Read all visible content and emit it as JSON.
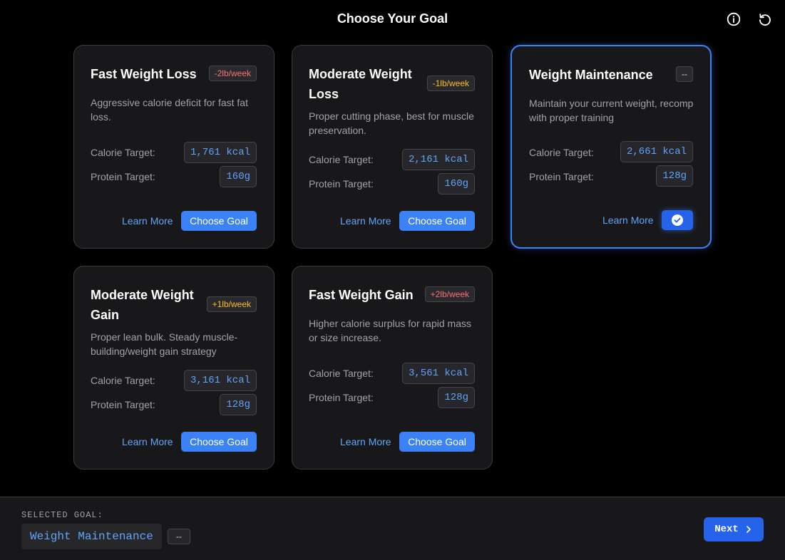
{
  "header": {
    "title": "Choose Your Goal",
    "icons": [
      "info-icon",
      "reset-icon"
    ]
  },
  "cards": [
    {
      "title": "Fast Weight Loss",
      "badge": "-2lb/week",
      "badge_color": "#f87171",
      "description": "Aggressive calorie deficit for fast fat loss.",
      "calorie_label": "Calorie Target:",
      "calorie_value": "1,761 kcal",
      "protein_label": "Protein Target:",
      "protein_value": "160g",
      "learn_more": "Learn More",
      "button": "Choose Goal",
      "selected": false
    },
    {
      "title": "Moderate Weight Loss",
      "badge": "-1lb/week",
      "badge_color": "#fbbf24",
      "description": "Proper cutting phase, best for muscle preservation.",
      "calorie_label": "Calorie Target:",
      "calorie_value": "2,161 kcal",
      "protein_label": "Protein Target:",
      "protein_value": "160g",
      "learn_more": "Learn More",
      "button": "Choose Goal",
      "selected": false
    },
    {
      "title": "Weight Maintenance",
      "badge": "--",
      "badge_color": "#d4d4d8",
      "description": "Maintain your current weight, recomp with proper training",
      "calorie_label": "Calorie Target:",
      "calorie_value": "2,661 kcal",
      "protein_label": "Protein Target:",
      "protein_value": "128g",
      "learn_more": "Learn More",
      "button_icon": "check-circle-icon",
      "selected": true
    },
    {
      "title": "Moderate Weight Gain",
      "badge": "+1lb/week",
      "badge_color": "#fbbf24",
      "description": "Proper lean bulk. Steady muscle-building/weight gain strategy",
      "calorie_label": "Calorie Target:",
      "calorie_value": "3,161 kcal",
      "protein_label": "Protein Target:",
      "protein_value": "128g",
      "learn_more": "Learn More",
      "button": "Choose Goal",
      "selected": false
    },
    {
      "title": "Fast Weight Gain",
      "badge": "+2lb/week",
      "badge_color": "#f87171",
      "description": "Higher calorie surplus for rapid mass or size increase.",
      "calorie_label": "Calorie Target:",
      "calorie_value": "3,561 kcal",
      "protein_label": "Protein Target:",
      "protein_value": "128g",
      "learn_more": "Learn More",
      "button": "Choose Goal",
      "selected": false
    }
  ],
  "footer": {
    "label": "SELECTED GOAL:",
    "selected_goal": "Weight Maintenance",
    "badge": "--",
    "next": "Next",
    "next_icon": "chevron-right-icon"
  },
  "colors": {
    "background": "#000000",
    "card": "#18181b",
    "accent": "#3b82f6",
    "value_text": "#60a5fa"
  }
}
